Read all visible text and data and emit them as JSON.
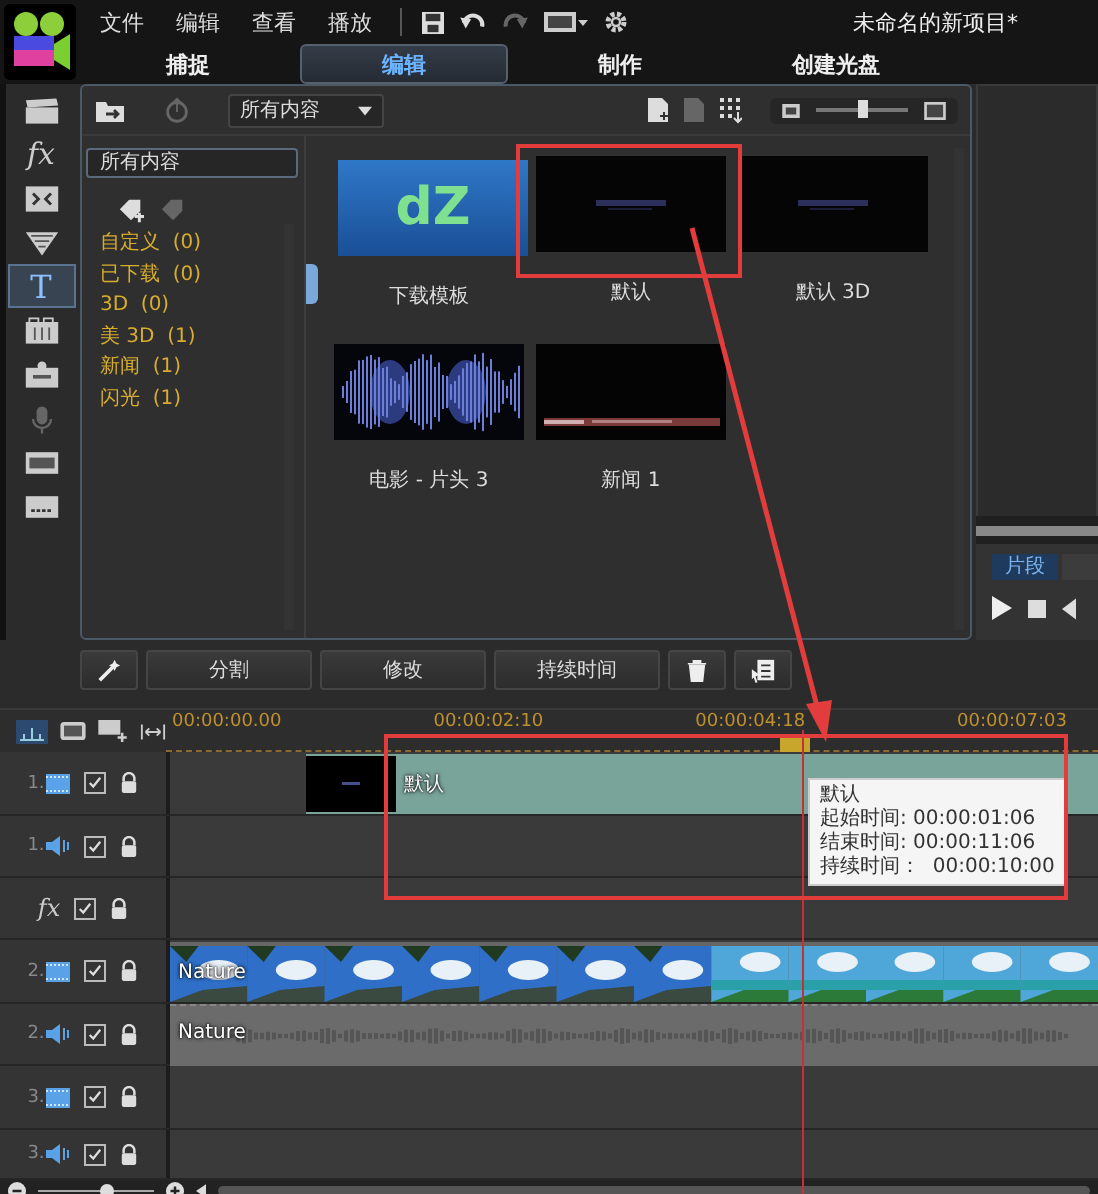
{
  "app": {
    "title": "未命名的新项目*"
  },
  "menu": [
    "文件",
    "编辑",
    "查看",
    "播放"
  ],
  "tabs": [
    {
      "label": "捕捉",
      "selected": false
    },
    {
      "label": "编辑",
      "selected": true
    },
    {
      "label": "制作",
      "selected": false
    },
    {
      "label": "创建光盘",
      "selected": false
    }
  ],
  "tools": [
    {
      "kind": "media",
      "selected": false,
      "disabled": false
    },
    {
      "kind": "fx",
      "label": "fx",
      "selected": false,
      "disabled": false
    },
    {
      "kind": "transition",
      "selected": false,
      "disabled": false
    },
    {
      "kind": "filter",
      "selected": false,
      "disabled": false
    },
    {
      "kind": "title",
      "label": "T",
      "selected": true,
      "disabled": false
    },
    {
      "kind": "graphics",
      "selected": false,
      "disabled": false
    },
    {
      "kind": "motion",
      "selected": false,
      "disabled": false
    },
    {
      "kind": "mic",
      "selected": false,
      "disabled": true
    },
    {
      "kind": "chapter",
      "selected": false,
      "disabled": false
    },
    {
      "kind": "subtitle",
      "selected": false,
      "disabled": false
    }
  ],
  "library": {
    "dropdown": "所有内容",
    "zoom": {
      "level": 0.5
    },
    "category_field": "所有内容",
    "categories": [
      "自定义  (0)",
      "已下载  (0)",
      "3D  (0)",
      "美 3D  (1)",
      "新闻  (1)",
      "闪光  (1)"
    ],
    "thumbnails": [
      {
        "label": "下载模板",
        "kind": "logo",
        "logo": "dZ"
      },
      {
        "label": "默认",
        "kind": "title"
      },
      {
        "label": "默认 3D",
        "kind": "title"
      },
      {
        "label": "电影 - 片头 3",
        "kind": "waveform"
      },
      {
        "label": "新闻 1",
        "kind": "news"
      }
    ]
  },
  "preview": {
    "tabs": [
      {
        "label": "片段",
        "selected": true
      }
    ]
  },
  "edit_buttons": [
    "分割",
    "修改",
    "持续时间"
  ],
  "timeline": {
    "ruler": [
      "00:00:00.00",
      "00:00:02:10",
      "00:00:04:18",
      "00:00:07:03"
    ],
    "tracks": [
      {
        "kind": "video",
        "number": "1.",
        "checked": true,
        "clip": {
          "kind": "title",
          "label": "默认"
        }
      },
      {
        "kind": "audio",
        "number": "1.",
        "checked": true
      },
      {
        "kind": "fx",
        "label": "fx",
        "checked": true
      },
      {
        "kind": "video",
        "number": "2.",
        "checked": true,
        "clip": {
          "kind": "video",
          "label": "Nature"
        }
      },
      {
        "kind": "audio",
        "number": "2.",
        "checked": true,
        "clip": {
          "kind": "audio",
          "label": "Nature"
        }
      },
      {
        "kind": "video",
        "number": "3.",
        "checked": true
      },
      {
        "kind": "audio",
        "number": "3.",
        "checked": true
      }
    ],
    "tooltip": [
      "默认",
      "起始时间: 00:00:01:06",
      "结束时间: 00:00:11:06",
      "持续时间：  00:00:10:00"
    ],
    "zoom": {
      "level": 0.58
    }
  }
}
